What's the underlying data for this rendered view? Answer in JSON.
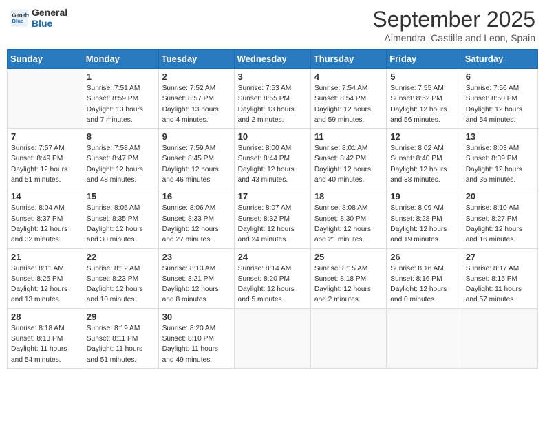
{
  "logo": {
    "line1": "General",
    "line2": "Blue"
  },
  "calendar": {
    "title": "September 2025",
    "subtitle": "Almendra, Castille and Leon, Spain"
  },
  "weekdays": [
    "Sunday",
    "Monday",
    "Tuesday",
    "Wednesday",
    "Thursday",
    "Friday",
    "Saturday"
  ],
  "weeks": [
    [
      {
        "day": "",
        "info": ""
      },
      {
        "day": "1",
        "info": "Sunrise: 7:51 AM\nSunset: 8:59 PM\nDaylight: 13 hours\nand 7 minutes."
      },
      {
        "day": "2",
        "info": "Sunrise: 7:52 AM\nSunset: 8:57 PM\nDaylight: 13 hours\nand 4 minutes."
      },
      {
        "day": "3",
        "info": "Sunrise: 7:53 AM\nSunset: 8:55 PM\nDaylight: 13 hours\nand 2 minutes."
      },
      {
        "day": "4",
        "info": "Sunrise: 7:54 AM\nSunset: 8:54 PM\nDaylight: 12 hours\nand 59 minutes."
      },
      {
        "day": "5",
        "info": "Sunrise: 7:55 AM\nSunset: 8:52 PM\nDaylight: 12 hours\nand 56 minutes."
      },
      {
        "day": "6",
        "info": "Sunrise: 7:56 AM\nSunset: 8:50 PM\nDaylight: 12 hours\nand 54 minutes."
      }
    ],
    [
      {
        "day": "7",
        "info": "Sunrise: 7:57 AM\nSunset: 8:49 PM\nDaylight: 12 hours\nand 51 minutes."
      },
      {
        "day": "8",
        "info": "Sunrise: 7:58 AM\nSunset: 8:47 PM\nDaylight: 12 hours\nand 48 minutes."
      },
      {
        "day": "9",
        "info": "Sunrise: 7:59 AM\nSunset: 8:45 PM\nDaylight: 12 hours\nand 46 minutes."
      },
      {
        "day": "10",
        "info": "Sunrise: 8:00 AM\nSunset: 8:44 PM\nDaylight: 12 hours\nand 43 minutes."
      },
      {
        "day": "11",
        "info": "Sunrise: 8:01 AM\nSunset: 8:42 PM\nDaylight: 12 hours\nand 40 minutes."
      },
      {
        "day": "12",
        "info": "Sunrise: 8:02 AM\nSunset: 8:40 PM\nDaylight: 12 hours\nand 38 minutes."
      },
      {
        "day": "13",
        "info": "Sunrise: 8:03 AM\nSunset: 8:39 PM\nDaylight: 12 hours\nand 35 minutes."
      }
    ],
    [
      {
        "day": "14",
        "info": "Sunrise: 8:04 AM\nSunset: 8:37 PM\nDaylight: 12 hours\nand 32 minutes."
      },
      {
        "day": "15",
        "info": "Sunrise: 8:05 AM\nSunset: 8:35 PM\nDaylight: 12 hours\nand 30 minutes."
      },
      {
        "day": "16",
        "info": "Sunrise: 8:06 AM\nSunset: 8:33 PM\nDaylight: 12 hours\nand 27 minutes."
      },
      {
        "day": "17",
        "info": "Sunrise: 8:07 AM\nSunset: 8:32 PM\nDaylight: 12 hours\nand 24 minutes."
      },
      {
        "day": "18",
        "info": "Sunrise: 8:08 AM\nSunset: 8:30 PM\nDaylight: 12 hours\nand 21 minutes."
      },
      {
        "day": "19",
        "info": "Sunrise: 8:09 AM\nSunset: 8:28 PM\nDaylight: 12 hours\nand 19 minutes."
      },
      {
        "day": "20",
        "info": "Sunrise: 8:10 AM\nSunset: 8:27 PM\nDaylight: 12 hours\nand 16 minutes."
      }
    ],
    [
      {
        "day": "21",
        "info": "Sunrise: 8:11 AM\nSunset: 8:25 PM\nDaylight: 12 hours\nand 13 minutes."
      },
      {
        "day": "22",
        "info": "Sunrise: 8:12 AM\nSunset: 8:23 PM\nDaylight: 12 hours\nand 10 minutes."
      },
      {
        "day": "23",
        "info": "Sunrise: 8:13 AM\nSunset: 8:21 PM\nDaylight: 12 hours\nand 8 minutes."
      },
      {
        "day": "24",
        "info": "Sunrise: 8:14 AM\nSunset: 8:20 PM\nDaylight: 12 hours\nand 5 minutes."
      },
      {
        "day": "25",
        "info": "Sunrise: 8:15 AM\nSunset: 8:18 PM\nDaylight: 12 hours\nand 2 minutes."
      },
      {
        "day": "26",
        "info": "Sunrise: 8:16 AM\nSunset: 8:16 PM\nDaylight: 12 hours\nand 0 minutes."
      },
      {
        "day": "27",
        "info": "Sunrise: 8:17 AM\nSunset: 8:15 PM\nDaylight: 11 hours\nand 57 minutes."
      }
    ],
    [
      {
        "day": "28",
        "info": "Sunrise: 8:18 AM\nSunset: 8:13 PM\nDaylight: 11 hours\nand 54 minutes."
      },
      {
        "day": "29",
        "info": "Sunrise: 8:19 AM\nSunset: 8:11 PM\nDaylight: 11 hours\nand 51 minutes."
      },
      {
        "day": "30",
        "info": "Sunrise: 8:20 AM\nSunset: 8:10 PM\nDaylight: 11 hours\nand 49 minutes."
      },
      {
        "day": "",
        "info": ""
      },
      {
        "day": "",
        "info": ""
      },
      {
        "day": "",
        "info": ""
      },
      {
        "day": "",
        "info": ""
      }
    ]
  ]
}
